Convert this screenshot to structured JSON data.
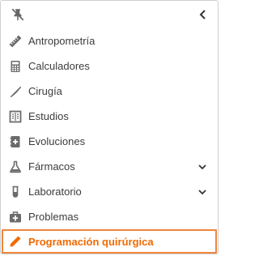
{
  "sidebar": {
    "items": [
      {
        "label": "Antropometría",
        "icon": "ruler-icon",
        "expandable": false
      },
      {
        "label": "Calculadores",
        "icon": "calculator-icon",
        "expandable": false
      },
      {
        "label": "Cirugía",
        "icon": "scalpel-icon",
        "expandable": false
      },
      {
        "label": "Estudios",
        "icon": "study-image-icon",
        "expandable": false
      },
      {
        "label": "Evoluciones",
        "icon": "medical-notebook-icon",
        "expandable": false
      },
      {
        "label": "Fármacos",
        "icon": "flask-icon",
        "expandable": true
      },
      {
        "label": "Laboratorio",
        "icon": "test-tube-icon",
        "expandable": true
      },
      {
        "label": "Problemas",
        "icon": "medical-kit-icon",
        "expandable": false
      },
      {
        "label": "Programación quirúrgica",
        "icon": "pencil-icon",
        "expandable": false,
        "active": true
      }
    ]
  },
  "colors": {
    "icon": "#6b6b6b",
    "text": "#3c3c3c",
    "active_text": "#f06a00",
    "active_border": "#f0853c"
  }
}
